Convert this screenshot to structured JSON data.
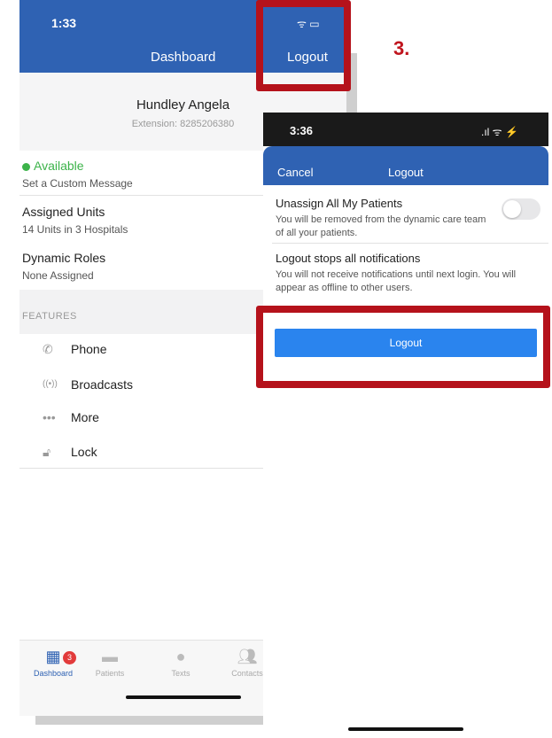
{
  "colors": {
    "header_blue": "#2f62b3",
    "button_blue": "#2a84ee",
    "highlight_red": "#b5121b",
    "available_green": "#3cb34a"
  },
  "step_label": "3.",
  "back_screen": {
    "time": "1:33",
    "title": "Dashboard",
    "logout": "Logout",
    "user_name": "Hundley Angela",
    "extension": "Extension: 8285206380",
    "status": "Available",
    "custom_message": "Set a Custom Message",
    "assigned_units_title": "Assigned Units",
    "assigned_units_value": "14 Units in 3 Hospitals",
    "dynamic_roles_title": "Dynamic Roles",
    "dynamic_roles_value": "None Assigned",
    "features_header": "FEATURES",
    "features": [
      {
        "label": "Phone",
        "icon": "phone-icon"
      },
      {
        "label": "Broadcasts",
        "icon": "broadcast-icon"
      },
      {
        "label": "More",
        "icon": "more-icon"
      },
      {
        "label": "Lock",
        "icon": "lock-icon"
      }
    ],
    "tabs": [
      {
        "label": "Dashboard",
        "icon": "grid-icon",
        "badge": "3"
      },
      {
        "label": "Patients",
        "icon": "bed-icon"
      },
      {
        "label": "Texts",
        "icon": "chat-icon"
      },
      {
        "label": "Contacts",
        "icon": "contacts-icon"
      }
    ]
  },
  "front_screen": {
    "time": "3:36",
    "cancel": "Cancel",
    "title": "Logout",
    "unassign_title": "Unassign All My Patients",
    "unassign_desc": "You will be removed from the dynamic care team of all your patients.",
    "unassign_toggle_on": false,
    "notif_title": "Logout stops all notifications",
    "notif_desc": "You will not receive notifications until next login. You will appear as offline to other users.",
    "logout_button": "Logout"
  }
}
